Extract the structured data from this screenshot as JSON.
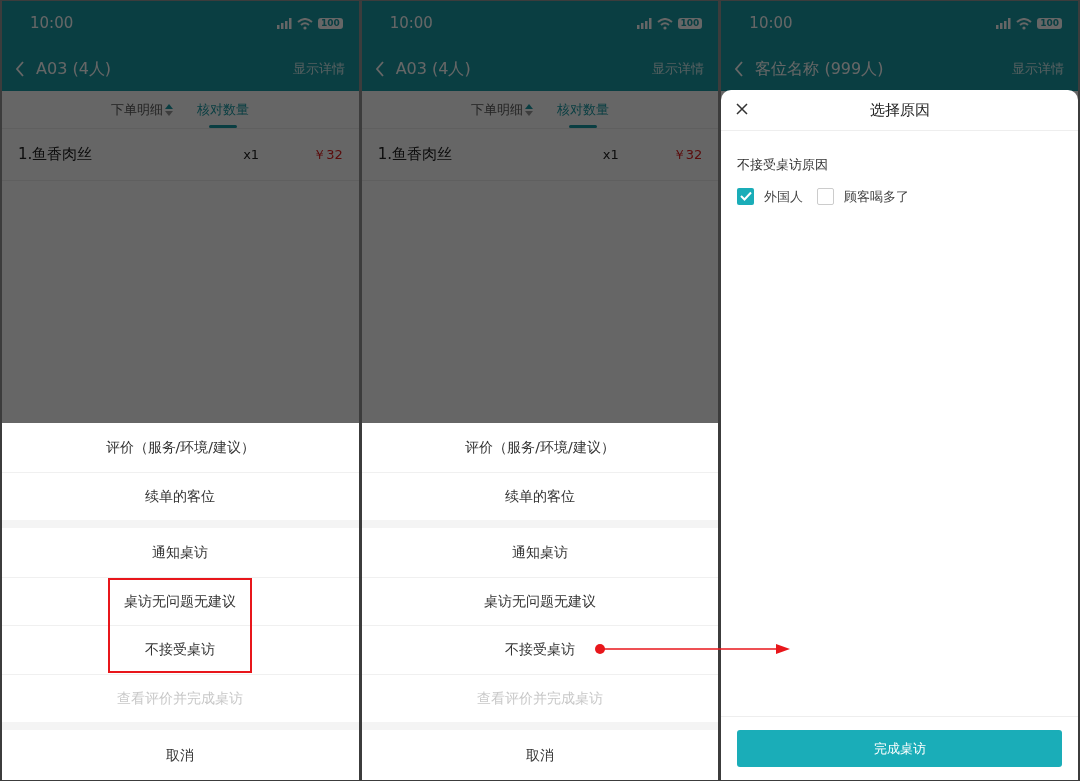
{
  "screens": [
    {
      "status_bar": {
        "time": "10:00",
        "battery": "100"
      },
      "nav": {
        "title": "A03 (4人)",
        "action": "显示详情"
      },
      "tabs": [
        {
          "label": "下单明细",
          "selected": false,
          "sortable": true
        },
        {
          "label": "核对数量",
          "selected": true,
          "sortable": false
        }
      ],
      "order_items": [
        {
          "name": "1.鱼香肉丝",
          "qty": "x1",
          "price": "￥32"
        }
      ],
      "action_sheet": {
        "groups": [
          [
            {
              "label": "评价（服务/环境/建议）",
              "disabled": false,
              "highlighted": false,
              "pointer": false
            },
            {
              "label": "续单的客位",
              "disabled": false,
              "highlighted": false,
              "pointer": false
            }
          ],
          [
            {
              "label": "通知桌访",
              "disabled": false,
              "highlighted": false,
              "pointer": false
            },
            {
              "label": "桌访无问题无建议",
              "disabled": false,
              "highlighted": true,
              "pointer": false
            },
            {
              "label": "不接受桌访",
              "disabled": false,
              "highlighted": true,
              "pointer": false
            },
            {
              "label": "查看评价并完成桌访",
              "disabled": true,
              "highlighted": false,
              "pointer": false
            }
          ]
        ],
        "cancel": "取消"
      }
    },
    {
      "status_bar": {
        "time": "10:00",
        "battery": "100"
      },
      "nav": {
        "title": "A03 (4人)",
        "action": "显示详情"
      },
      "tabs": [
        {
          "label": "下单明细",
          "selected": false,
          "sortable": true
        },
        {
          "label": "核对数量",
          "selected": true,
          "sortable": false
        }
      ],
      "order_items": [
        {
          "name": "1.鱼香肉丝",
          "qty": "x1",
          "price": "￥32"
        }
      ],
      "action_sheet": {
        "groups": [
          [
            {
              "label": "评价（服务/环境/建议）",
              "disabled": false,
              "highlighted": false,
              "pointer": false
            },
            {
              "label": "续单的客位",
              "disabled": false,
              "highlighted": false,
              "pointer": false
            }
          ],
          [
            {
              "label": "通知桌访",
              "disabled": false,
              "highlighted": false,
              "pointer": false
            },
            {
              "label": "桌访无问题无建议",
              "disabled": false,
              "highlighted": false,
              "pointer": false
            },
            {
              "label": "不接受桌访",
              "disabled": false,
              "highlighted": false,
              "pointer": true
            },
            {
              "label": "查看评价并完成桌访",
              "disabled": true,
              "highlighted": false,
              "pointer": false
            }
          ]
        ],
        "cancel": "取消"
      }
    },
    {
      "status_bar": {
        "time": "10:00",
        "battery": "100"
      },
      "nav": {
        "title": "客位名称 (999人)",
        "action": "显示详情"
      },
      "reason_sheet": {
        "title": "选择原因",
        "section": "不接受桌访原因",
        "options": [
          {
            "label": "外国人",
            "checked": true
          },
          {
            "label": "顾客喝多了",
            "checked": false
          }
        ],
        "submit": "完成桌访"
      }
    }
  ]
}
